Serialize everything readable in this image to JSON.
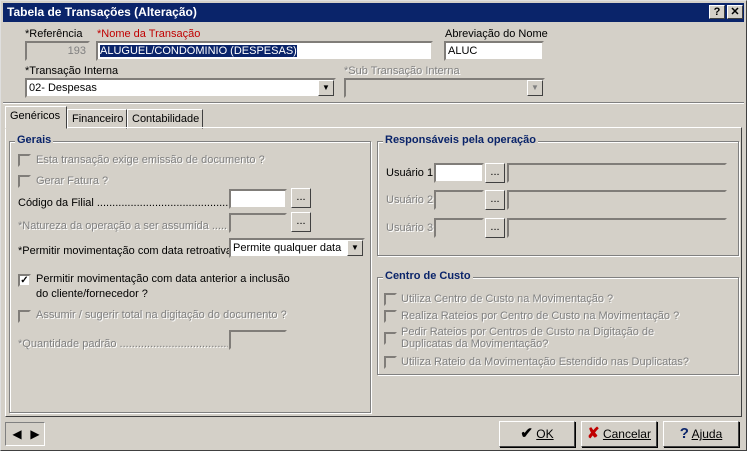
{
  "window": {
    "title": "Tabela de Transações (Alteração)",
    "help_btn": "?",
    "close_btn": "✕"
  },
  "header": {
    "ref_label": "*Referência",
    "ref_value": "193",
    "nome_label": "*Nome da Transação",
    "nome_value": "ALUGUEL/CONDOMINIO (DESPESAS)",
    "abrev_label": "Abreviação do Nome",
    "abrev_value": "ALUC",
    "transacao_label": "*Transação Interna",
    "transacao_value": "02- Despesas",
    "sub_label": "*Sub Transação Interna",
    "sub_value": ""
  },
  "tabs": [
    {
      "label": "Genéricos"
    },
    {
      "label": "Financeiro"
    },
    {
      "label": "Contabilidade"
    }
  ],
  "gerais": {
    "title": "Gerais",
    "emissao_label": "Esta transação exige emissão de documento ?",
    "fatura_label": "Gerar Fatura ?",
    "filial_label": "Código da Filial ..............................................",
    "natureza_label": "*Natureza da operação a ser assumida ........",
    "retro_label": "*Permitir movimentação com data retroativa?",
    "retro_value": "Permite qualquer data",
    "anterior_label_1": "Permitir movimentação com data anterior a inclusão",
    "anterior_label_2": "do cliente/fornecedor ?",
    "assumir_label": "Assumir / sugerir total na digitação do documento ?",
    "qtd_label": "*Quantidade padrão ....................................",
    "browse": "..."
  },
  "responsaveis": {
    "title": "Responsáveis pela operação",
    "users": [
      {
        "label": "Usuário 1"
      },
      {
        "label": "Usuário 2"
      },
      {
        "label": "Usuário 3"
      }
    ],
    "browse": "..."
  },
  "custo": {
    "title": "Centro de Custo",
    "opt1": "Utiliza Centro de Custo na Movimentação ?",
    "opt2": "Realiza Rateios por Centro de Custo na Movimentação ?",
    "opt3_1": "Pedir Rateios por Centros de Custo na Digitação de",
    "opt3_2": "Duplicatas da Movimentação?",
    "opt4": "Utiliza Rateio da Movimentação Estendido nas Duplicatas?"
  },
  "footer": {
    "ok": "OK",
    "cancelar": "Cancelar",
    "ajuda": "Ajuda"
  },
  "colors": {
    "title_bar": "#0a246a",
    "face": "#d4d0c8",
    "required": "#c00000",
    "group_title": "#0a246a"
  }
}
